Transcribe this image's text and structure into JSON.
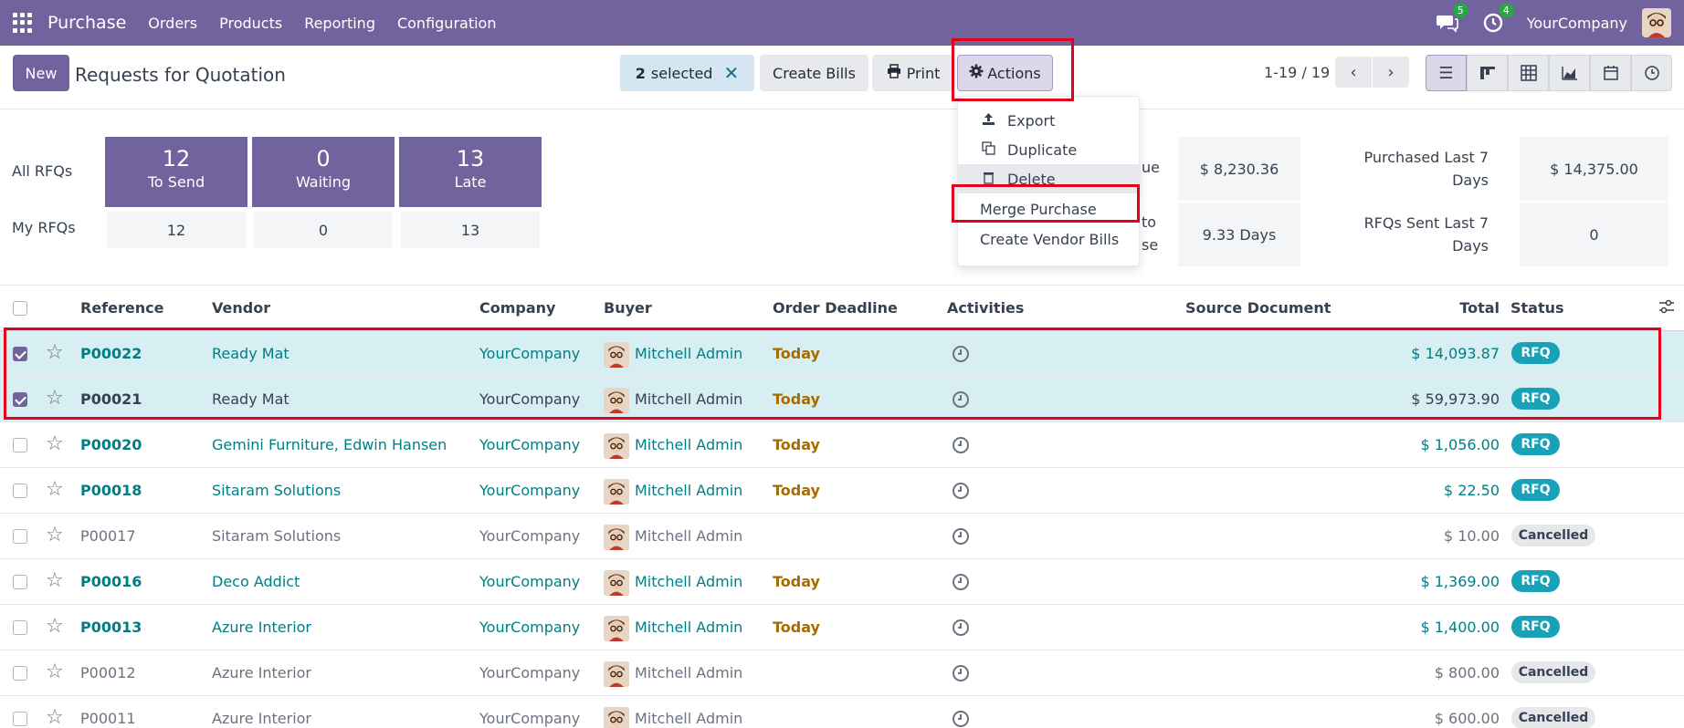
{
  "navbar": {
    "app_name": "Purchase",
    "menu": [
      "Orders",
      "Products",
      "Reporting",
      "Configuration"
    ],
    "chat_count": "5",
    "activity_count": "4",
    "company": "YourCompany"
  },
  "control_panel": {
    "new_label": "New",
    "title": "Requests for Quotation",
    "selected_count": "2",
    "selected_text": "selected",
    "create_bills_label": "Create Bills",
    "print_label": "Print",
    "actions_label": "Actions",
    "pager": "1-19 / 19"
  },
  "actions_menu": {
    "items": [
      "Export",
      "Duplicate",
      "Delete",
      "Merge Purchase",
      "Create Vendor Bills"
    ]
  },
  "dashboard": {
    "all_rfqs_label": "All RFQs",
    "my_rfqs_label": "My RFQs",
    "tiles": [
      {
        "num": "12",
        "label": "To Send",
        "mine": "12"
      },
      {
        "num": "0",
        "label": "Waiting",
        "mine": "0"
      },
      {
        "num": "13",
        "label": "Late",
        "mine": "13"
      }
    ],
    "partial_label_1": "ue",
    "partial_label_2a": "to",
    "partial_label_2b": "se",
    "avg_order_value": "$ 8,230.36",
    "lead_days": "9.33 Days",
    "purchased_label_1": "Purchased Last 7",
    "purchased_label_2": "Days",
    "purchased_value": "$ 14,375.00",
    "sent_label_1": "RFQs Sent Last 7",
    "sent_label_2": "Days",
    "sent_value": "0"
  },
  "table": {
    "headers": {
      "reference": "Reference",
      "vendor": "Vendor",
      "company": "Company",
      "buyer": "Buyer",
      "deadline": "Order Deadline",
      "activities": "Activities",
      "source": "Source Document",
      "total": "Total",
      "status": "Status"
    },
    "rows": [
      {
        "ref": "P00022",
        "vendor": "Ready Mat",
        "company": "YourCompany",
        "buyer": "Mitchell Admin",
        "deadline": "Today",
        "total": "$ 14,093.87",
        "status": "RFQ"
      },
      {
        "ref": "P00021",
        "vendor": "Ready Mat",
        "company": "YourCompany",
        "buyer": "Mitchell Admin",
        "deadline": "Today",
        "total": "$ 59,973.90",
        "status": "RFQ"
      },
      {
        "ref": "P00020",
        "vendor": "Gemini Furniture, Edwin Hansen",
        "company": "YourCompany",
        "buyer": "Mitchell Admin",
        "deadline": "Today",
        "total": "$ 1,056.00",
        "status": "RFQ"
      },
      {
        "ref": "P00018",
        "vendor": "Sitaram Solutions",
        "company": "YourCompany",
        "buyer": "Mitchell Admin",
        "deadline": "Today",
        "total": "$ 22.50",
        "status": "RFQ"
      },
      {
        "ref": "P00017",
        "vendor": "Sitaram Solutions",
        "company": "YourCompany",
        "buyer": "Mitchell Admin",
        "deadline": "",
        "total": "$ 10.00",
        "status": "Cancelled"
      },
      {
        "ref": "P00016",
        "vendor": "Deco Addict",
        "company": "YourCompany",
        "buyer": "Mitchell Admin",
        "deadline": "Today",
        "total": "$ 1,369.00",
        "status": "RFQ"
      },
      {
        "ref": "P00013",
        "vendor": "Azure Interior",
        "company": "YourCompany",
        "buyer": "Mitchell Admin",
        "deadline": "Today",
        "total": "$ 1,400.00",
        "status": "RFQ"
      },
      {
        "ref": "P00012",
        "vendor": "Azure Interior",
        "company": "YourCompany",
        "buyer": "Mitchell Admin",
        "deadline": "",
        "total": "$ 800.00",
        "status": "Cancelled"
      },
      {
        "ref": "P00011",
        "vendor": "Azure Interior",
        "company": "YourCompany",
        "buyer": "Mitchell Admin",
        "deadline": "",
        "total": "$ 600.00",
        "status": "Cancelled"
      }
    ]
  },
  "colors": {
    "brand": "#71639e",
    "link": "#017e84",
    "rfq_badge": "#17a2b8",
    "highlight_box": "#e3001b"
  }
}
